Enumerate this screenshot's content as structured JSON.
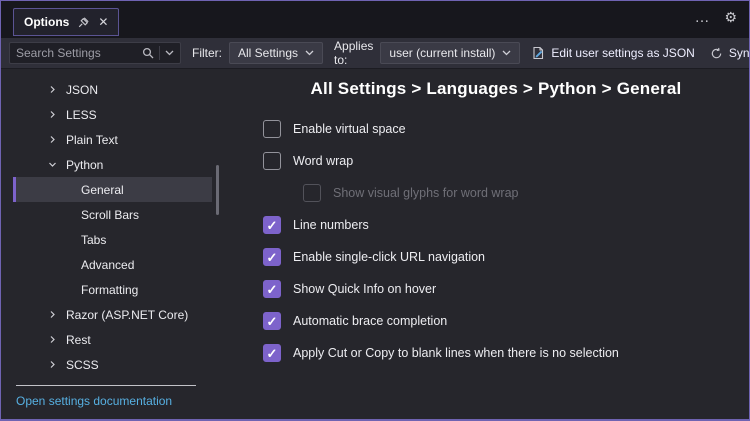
{
  "window": {
    "title": "Options",
    "more_label": "…"
  },
  "toolbar": {
    "search_placeholder": "Search Settings",
    "filter_label": "Filter:",
    "filter_value": "All Settings",
    "applies_label": "Applies to:",
    "applies_value": "user (current install)",
    "edit_json_label": "Edit user settings as JSON",
    "sync_label": "Sync"
  },
  "sidebar": {
    "items": [
      {
        "label": "JSON",
        "level": "top",
        "state": "collapsed"
      },
      {
        "label": "LESS",
        "level": "top",
        "state": "collapsed"
      },
      {
        "label": "Plain Text",
        "level": "top",
        "state": "collapsed"
      },
      {
        "label": "Python",
        "level": "top",
        "state": "expanded"
      },
      {
        "label": "General",
        "level": "child",
        "selected": true
      },
      {
        "label": "Scroll Bars",
        "level": "child",
        "selected": false
      },
      {
        "label": "Tabs",
        "level": "child",
        "selected": false
      },
      {
        "label": "Advanced",
        "level": "child",
        "selected": false
      },
      {
        "label": "Formatting",
        "level": "child",
        "selected": false
      },
      {
        "label": "Razor (ASP.NET Core)",
        "level": "top",
        "state": "collapsed"
      },
      {
        "label": "Rest",
        "level": "top",
        "state": "collapsed"
      },
      {
        "label": "SCSS",
        "level": "top",
        "state": "collapsed"
      }
    ],
    "doc_link_label": "Open settings documentation"
  },
  "main": {
    "breadcrumb": "All Settings > Languages > Python > General",
    "settings": [
      {
        "label": "Enable virtual space",
        "checked": false,
        "disabled": false,
        "indent": false
      },
      {
        "label": "Word wrap",
        "checked": false,
        "disabled": false,
        "indent": false
      },
      {
        "label": "Show visual glyphs for word wrap",
        "checked": false,
        "disabled": true,
        "indent": true
      },
      {
        "label": "Line numbers",
        "checked": true,
        "disabled": false,
        "indent": false
      },
      {
        "label": "Enable single-click URL navigation",
        "checked": true,
        "disabled": false,
        "indent": false
      },
      {
        "label": "Show Quick Info on hover",
        "checked": true,
        "disabled": false,
        "indent": false
      },
      {
        "label": "Automatic brace completion",
        "checked": true,
        "disabled": false,
        "indent": false
      },
      {
        "label": "Apply Cut or Copy to blank lines when there is no selection",
        "checked": true,
        "disabled": false,
        "indent": false
      }
    ]
  },
  "colors": {
    "accent": "#7d63cb",
    "window_border": "#6f63b2",
    "link": "#57b0e2",
    "selected_bg": "#3c3c45"
  }
}
